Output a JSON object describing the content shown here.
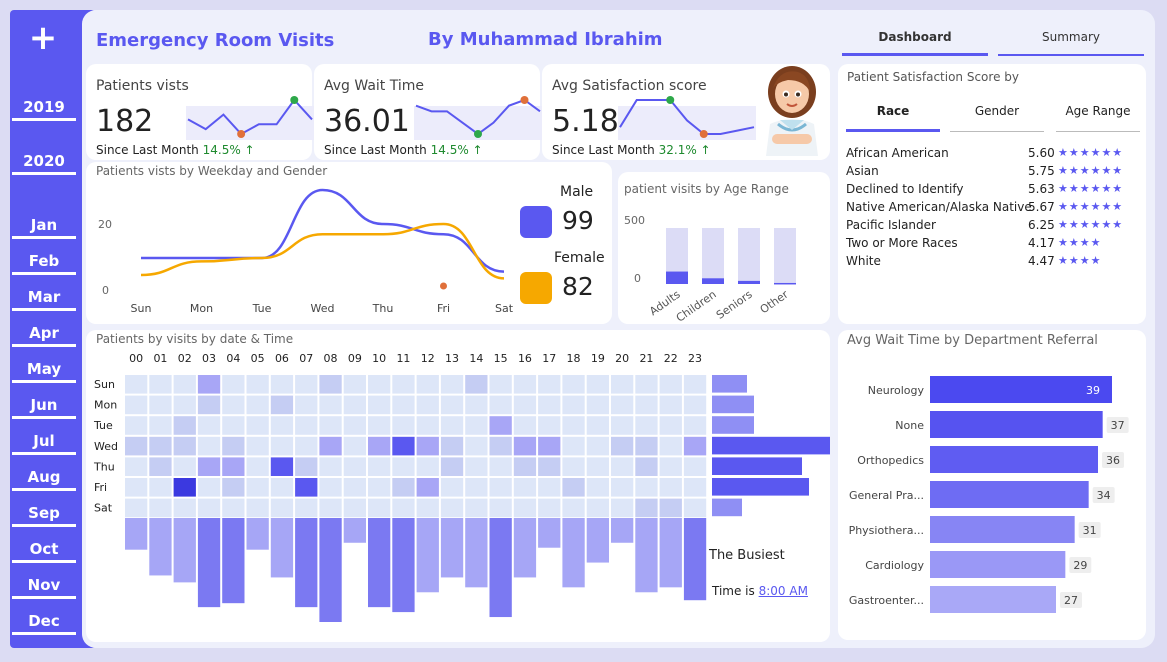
{
  "sidebar": {
    "plus_icon": "+",
    "years": [
      "2019",
      "2020"
    ],
    "months": [
      "Jan",
      "Feb",
      "Mar",
      "Apr",
      "May",
      "Jun",
      "Jul",
      "Aug",
      "Sep",
      "Oct",
      "Nov",
      "Dec"
    ]
  },
  "header": {
    "title": "Emergency Room Visits",
    "author": "By Muhammad Ibrahim"
  },
  "tabs": [
    {
      "label": "Dashboard",
      "active": true
    },
    {
      "label": "Summary",
      "active": false
    }
  ],
  "kpis": [
    {
      "title": "Patients vists",
      "value": "182",
      "sub_label": "Since Last Month",
      "change": "14.5% ↑",
      "spark": [
        4,
        2,
        5,
        1,
        3,
        3,
        8,
        4
      ],
      "dot_max_index": 6,
      "dot_min_index": 3
    },
    {
      "title": "Avg Wait Time",
      "value": "36.01",
      "sub_label": "Since Last Month",
      "change": "14.5% ↑",
      "spark": [
        7,
        6,
        6,
        4,
        2,
        4,
        7,
        8,
        6
      ],
      "dot_max_index": 7,
      "dot_min_index": 4
    },
    {
      "title": "Avg Satisfaction score",
      "value": "5.18",
      "sub_label": "Since Last Month",
      "change": "32.1% ↑",
      "spark": [
        2,
        6,
        6,
        6,
        3,
        1,
        1,
        1.5,
        2
      ],
      "dot_max_index": 3,
      "dot_min_index": 5
    }
  ],
  "gender_chart": {
    "title": "Patients vists by Weekday and Gender",
    "yticks": [
      "20",
      "0"
    ],
    "chart_data": {
      "type": "line",
      "categories": [
        "Sun",
        "Mon",
        "Tue",
        "Wed",
        "Thu",
        "Fri",
        "Sat"
      ],
      "ylim": [
        0,
        30
      ],
      "series": [
        {
          "name": "Male",
          "color": "#5a58f0",
          "values": [
            10,
            10,
            10,
            30,
            20,
            17,
            6
          ]
        },
        {
          "name": "Female",
          "color": "#f6a800",
          "values": [
            5,
            9,
            10,
            17,
            17,
            20,
            4
          ]
        }
      ]
    },
    "male_label": "Male",
    "male_value": "99",
    "female_label": "Female",
    "female_value": "82"
  },
  "age_chart": {
    "title": "patient visits by Age Range",
    "yticks": [
      "500",
      "0"
    ],
    "chart_data": {
      "type": "bar",
      "categories": [
        "Adults",
        "Children",
        "Seniors",
        "Other"
      ],
      "values": [
        120,
        55,
        30,
        10
      ],
      "ylim": [
        0,
        540
      ]
    }
  },
  "satisfaction": {
    "title": "Patient Satisfaction Score by",
    "tabs": [
      "Race",
      "Gender",
      "Age Range"
    ],
    "active_tab": 0,
    "rows": [
      {
        "name": "African American",
        "value": "5.60",
        "stars": "★★★★★★"
      },
      {
        "name": "Asian",
        "value": "5.75",
        "stars": "★★★★★★"
      },
      {
        "name": "Declined to Identify",
        "value": "5.63",
        "stars": "★★★★★★"
      },
      {
        "name": "Native American/Alaska Native",
        "value": "5.67",
        "stars": "★★★★★★"
      },
      {
        "name": "Pacific Islander",
        "value": "6.25",
        "stars": "★★★★★★"
      },
      {
        "name": "Two or More Races",
        "value": "4.17",
        "stars": "★★★★"
      },
      {
        "name": "White",
        "value": "4.47",
        "stars": "★★★★"
      }
    ]
  },
  "heatmap": {
    "title": "Patients by visits by date & Time",
    "hours": [
      "00",
      "01",
      "02",
      "03",
      "04",
      "05",
      "06",
      "07",
      "08",
      "09",
      "10",
      "11",
      "12",
      "13",
      "14",
      "15",
      "16",
      "17",
      "18",
      "19",
      "20",
      "21",
      "22",
      "23"
    ],
    "days": [
      "Sun",
      "Mon",
      "Tue",
      "Wed",
      "Thu",
      "Fri",
      "Sat"
    ],
    "cells": [
      [
        0,
        0,
        0,
        3,
        1,
        0,
        0,
        0,
        2,
        0,
        0,
        0,
        0,
        0,
        2,
        0,
        0,
        0,
        0,
        0,
        0,
        0,
        1,
        1
      ],
      [
        1,
        1,
        1,
        2,
        1,
        0,
        2,
        1,
        1,
        1,
        0,
        1,
        1,
        1,
        1,
        1,
        1,
        0,
        1,
        1,
        1,
        1,
        1,
        1
      ],
      [
        1,
        1,
        2,
        1,
        1,
        1,
        1,
        1,
        1,
        1,
        1,
        1,
        1,
        1,
        1,
        3,
        1,
        1,
        1,
        1,
        1,
        1,
        1,
        1
      ],
      [
        2,
        2,
        2,
        1,
        2,
        1,
        1,
        1,
        3,
        1,
        3,
        4,
        3,
        2,
        1,
        2,
        3,
        3,
        1,
        1,
        2,
        2,
        1,
        3
      ],
      [
        1,
        2,
        1,
        3,
        3,
        1,
        4,
        2,
        1,
        1,
        1,
        1,
        1,
        2,
        1,
        1,
        2,
        2,
        1,
        1,
        1,
        2,
        1,
        1
      ],
      [
        1,
        1,
        5,
        1,
        2,
        1,
        1,
        4,
        1,
        1,
        1,
        2,
        3,
        1,
        1,
        1,
        1,
        1,
        2,
        1,
        1,
        1,
        1,
        1
      ],
      [
        1,
        1,
        1,
        1,
        1,
        1,
        1,
        1,
        1,
        1,
        1,
        1,
        1,
        1,
        1,
        1,
        1,
        1,
        1,
        1,
        1,
        2,
        2,
        1
      ]
    ],
    "row_totals": [
      35,
      42,
      42,
      118,
      90,
      97,
      30
    ],
    "col_totals": [
      32,
      58,
      65,
      90,
      86,
      32,
      60,
      90,
      105,
      25,
      90,
      95,
      75,
      60,
      70,
      100,
      60,
      30,
      70,
      45,
      25,
      75,
      70,
      83
    ],
    "busiest_label": "The Busiest",
    "time_label": "Time is",
    "time_value": "8:00 AM"
  },
  "wait_chart": {
    "title": "Avg Wait Time by Department Referral",
    "chart_data": {
      "type": "bar",
      "categories": [
        "Neurology",
        "None",
        "Orthopedics",
        "General Pra...",
        "Physiothera...",
        "Cardiology",
        "Gastroenter..."
      ],
      "values": [
        39,
        37,
        36,
        34,
        31,
        29,
        27
      ],
      "xlim": [
        0,
        42
      ]
    }
  },
  "colors": {
    "accent": "#5a58f0",
    "female": "#f6a800",
    "green": "#1e8a2e"
  }
}
